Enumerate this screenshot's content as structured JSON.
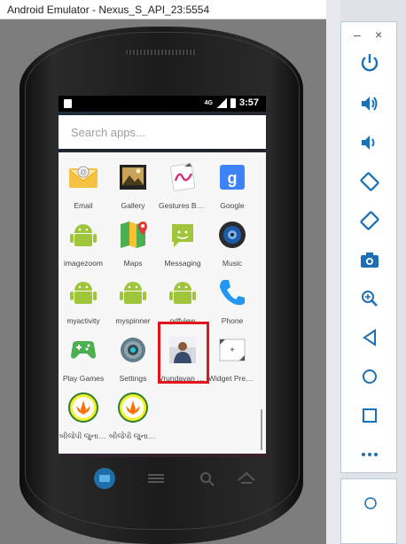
{
  "window": {
    "title": "Android Emulator - Nexus_S_API_23:5554"
  },
  "status_bar": {
    "time": "3:57",
    "network": "4G"
  },
  "search": {
    "placeholder": "Search apps..."
  },
  "apps": [
    {
      "label": "Email",
      "icon": "email-icon"
    },
    {
      "label": "Gallery",
      "icon": "gallery-icon"
    },
    {
      "label": "Gestures Buil...",
      "icon": "gestures-builder-icon"
    },
    {
      "label": "Google",
      "icon": "google-icon"
    },
    {
      "label": "imagezoom",
      "icon": "android-icon"
    },
    {
      "label": "Maps",
      "icon": "maps-icon"
    },
    {
      "label": "Messaging",
      "icon": "messaging-icon"
    },
    {
      "label": "Music",
      "icon": "music-icon"
    },
    {
      "label": "myactivity",
      "icon": "android-icon"
    },
    {
      "label": "myspinner",
      "icon": "android-icon"
    },
    {
      "label": "pdfview",
      "icon": "android-icon"
    },
    {
      "label": "Phone",
      "icon": "phone-icon"
    },
    {
      "label": "Play Games",
      "icon": "play-games-icon"
    },
    {
      "label": "Settings",
      "icon": "settings-icon"
    },
    {
      "label": "Vrundavan C...",
      "icon": "profile-photo-icon"
    },
    {
      "label": "Widget Previ...",
      "icon": "widget-preview-icon"
    },
    {
      "label": "બીજેપી જુનાગ...",
      "icon": "bjp-logo-icon"
    },
    {
      "label": "બીજેપી જુનાગ...",
      "icon": "bjp-logo-icon"
    }
  ],
  "controls": [
    "power-icon",
    "volume-up-icon",
    "volume-down-icon",
    "rotate-left-icon",
    "rotate-right-icon",
    "camera-icon",
    "zoom-icon",
    "back-icon",
    "home-icon",
    "overview-icon",
    "more-icon"
  ],
  "colors": {
    "highlight": "#e3141b",
    "android_green": "#9fc63b",
    "controls_accent": "#1a6fb5"
  }
}
